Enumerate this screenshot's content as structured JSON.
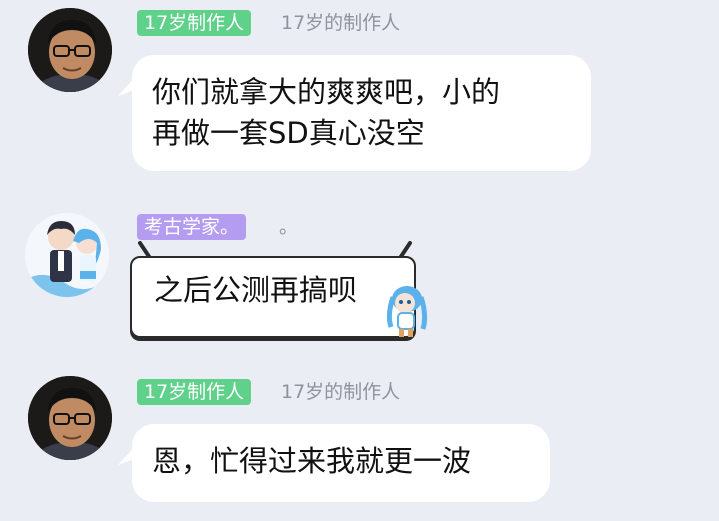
{
  "messages": [
    {
      "badge": "17岁制作人",
      "nickname": "17岁的制作人",
      "avatar": "man-avatar",
      "lines": [
        "你们就拿大的爽爽吧，小的",
        "再做一套SD真心没空"
      ]
    },
    {
      "badge": "考古学家。",
      "nickname": "。",
      "avatar": "anime-couple-avatar",
      "lines": [
        "之后公测再搞呗"
      ]
    },
    {
      "badge": "17岁制作人",
      "nickname": "17岁的制作人",
      "avatar": "man-avatar",
      "lines": [
        "恩，忙得过来我就更一波"
      ]
    }
  ],
  "colors": {
    "background": "#eaedf4",
    "badge_green": "#5fd18a",
    "badge_purple": "#b49cf0",
    "nickname": "#8e939c",
    "bubble": "#ffffff"
  }
}
